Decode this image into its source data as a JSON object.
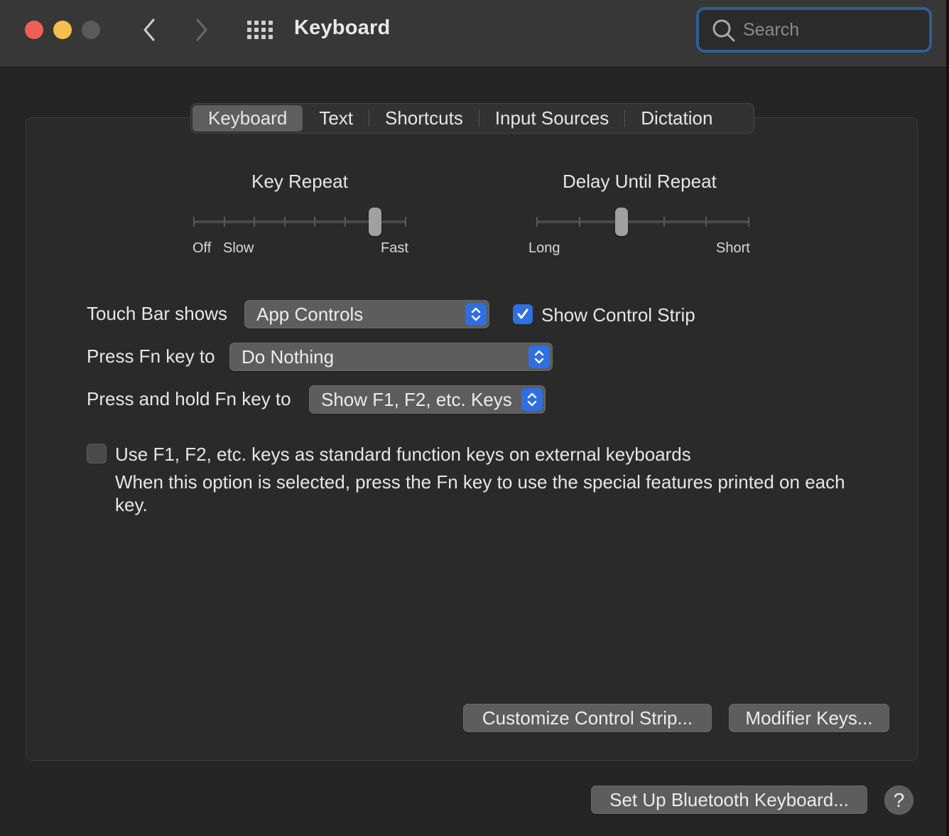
{
  "window": {
    "title": "Keyboard",
    "search": {
      "placeholder": "Search",
      "value": ""
    }
  },
  "tabs": [
    {
      "label": "Keyboard",
      "selected": true
    },
    {
      "label": "Text",
      "selected": false
    },
    {
      "label": "Shortcuts",
      "selected": false
    },
    {
      "label": "Input Sources",
      "selected": false
    },
    {
      "label": "Dictation",
      "selected": false
    }
  ],
  "key_repeat": {
    "title": "Key Repeat",
    "labels": {
      "off": "Off",
      "slow": "Slow",
      "fast": "Fast"
    },
    "steps": 8,
    "position": 6
  },
  "delay_until_repeat": {
    "title": "Delay Until Repeat",
    "labels": {
      "long": "Long",
      "short": "Short"
    },
    "steps": 6,
    "position": 2
  },
  "touch_bar": {
    "label": "Touch Bar shows",
    "value": "App Controls",
    "show_control_strip": {
      "label": "Show Control Strip",
      "checked": true
    }
  },
  "fn_key": {
    "label": "Press Fn key to",
    "value": "Do Nothing"
  },
  "hold_fn_key": {
    "label": "Press and hold Fn key to",
    "value": "Show F1, F2, etc. Keys"
  },
  "function_keys": {
    "label": "Use F1, F2, etc. keys as standard function keys on external keyboards",
    "checked": false,
    "help": "When this option is selected, press the Fn key to use the special features printed on each key."
  },
  "buttons": {
    "customize_control_strip": "Customize Control Strip...",
    "modifier_keys": "Modifier Keys...",
    "setup_bluetooth": "Set Up Bluetooth Keyboard...",
    "help": "?"
  },
  "colors": {
    "accent": "#2f6fe0",
    "close": "#ed5f57",
    "minimize": "#f5be4f"
  }
}
